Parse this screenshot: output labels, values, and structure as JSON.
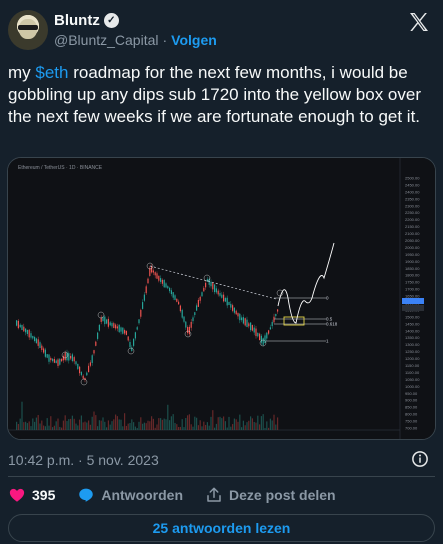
{
  "author": {
    "name": "Bluntz",
    "handle": "@Bluntz_Capital",
    "separator": "·",
    "follow_label": "Volgen"
  },
  "tweet": {
    "text_before": "my ",
    "cashtag": "$eth",
    "text_after": " roadmap for the next few months, i would be gobbling up any dips sub 1720 into the yellow box over the next few weeks if we are fortunate enough to get it."
  },
  "chart": {
    "header_text": "Ethereum / TetherUS · 1D · BINANCE",
    "price_axis": [
      "2500.00",
      "2450.00",
      "2400.00",
      "2350.00",
      "2300.00",
      "2250.00",
      "2200.00",
      "2150.00",
      "2100.00",
      "2050.00",
      "2000.00",
      "1950.00",
      "1900.00",
      "1850.00",
      "1800.00",
      "1750.00",
      "1700.00",
      "1650.00",
      "1600.00",
      "1550.00",
      "1500.00",
      "1450.00",
      "1400.00",
      "1350.00",
      "1300.00",
      "1250.00",
      "1200.00",
      "1150.00",
      "1100.00",
      "1050.00",
      "1000.00",
      "950.00",
      "900.00",
      "850.00",
      "800.00",
      "750.00",
      "700.00"
    ],
    "labels": {
      "fib_0": "0",
      "fib_05": "0.5",
      "fib_0618": "0.618",
      "fib_1": "1"
    },
    "colors": {
      "up": "#26a69a",
      "down": "#ef5350",
      "box": "#e6d84a",
      "projection": "#ffffff"
    }
  },
  "meta": {
    "timestamp": "10:42 p.m. · 5 nov. 2023"
  },
  "actions": {
    "likes": "395",
    "reply_label": "Antwoorden",
    "share_label": "Deze post delen"
  },
  "read_replies": "25 antwoorden lezen",
  "icons": {
    "verified": "verified-badge-icon",
    "x_logo": "x-logo-icon",
    "info": "info-icon",
    "like": "heart-icon",
    "reply": "speech-bubble-icon",
    "share": "share-icon"
  }
}
